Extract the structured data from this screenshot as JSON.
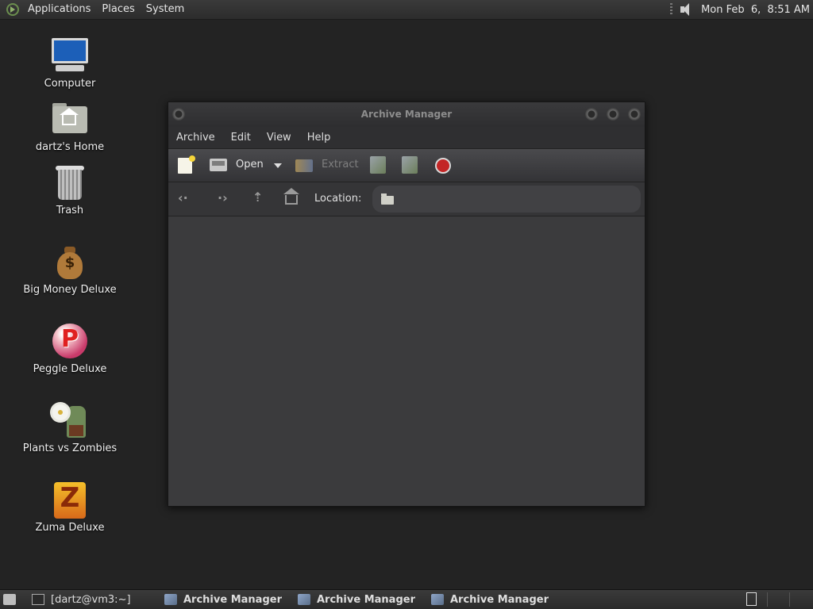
{
  "top_panel": {
    "menus": [
      "Applications",
      "Places",
      "System"
    ],
    "clock": "Mon Feb  6,  8:51 AM",
    "icons": [
      "distro-logo-icon",
      "volume-icon"
    ]
  },
  "desktop": {
    "icons": [
      {
        "label": "Computer",
        "icon": "computer-icon"
      },
      {
        "label": "dartz's Home",
        "icon": "home-folder-icon"
      },
      {
        "label": "Trash",
        "icon": "trash-icon"
      },
      {
        "label": "Big Money Deluxe",
        "icon": "money-bag-icon"
      },
      {
        "label": "Peggle Deluxe",
        "icon": "peggle-icon"
      },
      {
        "label": "Plants vs Zombies",
        "icon": "plants-zombies-icon"
      },
      {
        "label": "Zuma Deluxe",
        "icon": "zuma-icon"
      }
    ]
  },
  "window": {
    "title": "Archive Manager",
    "menu": [
      "Archive",
      "Edit",
      "View",
      "Help"
    ],
    "toolbar": {
      "open_label": "Open",
      "extract_label": "Extract"
    },
    "location": {
      "label": "Location:",
      "value": ""
    }
  },
  "taskbar": {
    "tasks": [
      {
        "label": "[dartz@vm3:~]",
        "icon": "terminal-icon",
        "active": false
      },
      {
        "label": "Archive Manager",
        "icon": "archive-icon",
        "active": true
      },
      {
        "label": "Archive Manager",
        "icon": "archive-icon",
        "active": true
      },
      {
        "label": "Archive Manager",
        "icon": "archive-icon",
        "active": true
      }
    ]
  }
}
